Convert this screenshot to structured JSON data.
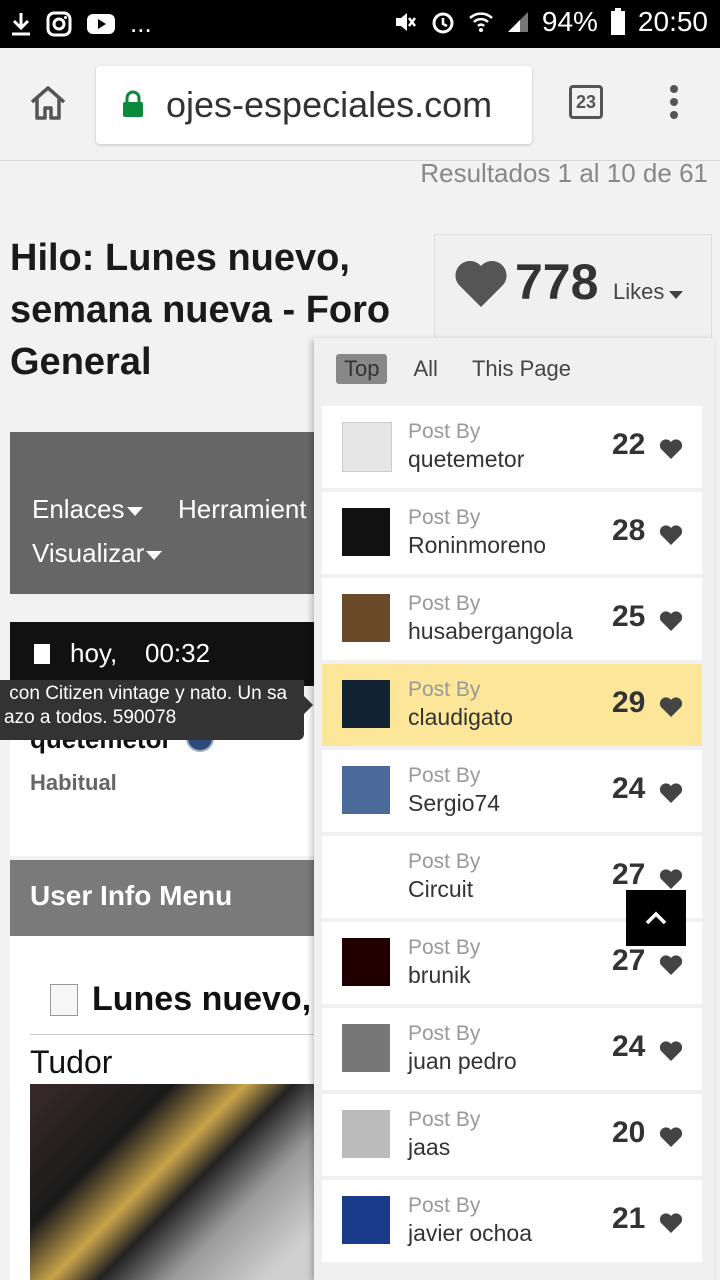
{
  "status_bar": {
    "left_icons": [
      "download-icon",
      "instagram-icon",
      "youtube-icon"
    ],
    "more": "...",
    "battery": "94%",
    "time": "20:50"
  },
  "browser": {
    "url": "ojes-especiales.com",
    "tab_count": "23"
  },
  "page": {
    "results_text": "Resultados 1 al 10 de 61",
    "thread_title": "Hilo: Lunes nuevo, semana nueva - Foro General",
    "nav": {
      "links": "Enlaces",
      "tools": "Herramient",
      "view": "Visualizar"
    },
    "date_day": "hoy,",
    "date_time": "00:32",
    "tooltip_text": " con Citizen vintage y nato. Un sa\nazo a todos. 590078",
    "username": "quetemetor",
    "user_rank": "Habitual",
    "user_info_menu": "User Info Menu",
    "post_title": "Lunes nuevo,",
    "post_brand": "Tudor"
  },
  "likes": {
    "count": "778",
    "label": "Likes",
    "filters": [
      "Top",
      "All",
      "This Page"
    ],
    "active_filter": "Top",
    "post_by_label": "Post By",
    "entries": [
      {
        "user": "quetemetor",
        "count": "22",
        "avatar": "default-avatar-icon",
        "highlight": false
      },
      {
        "user": "Roninmoreno",
        "count": "28",
        "avatar": "skull-avatar",
        "highlight": false
      },
      {
        "user": "husabergangola",
        "count": "25",
        "avatar": "motorcycle-avatar",
        "highlight": false
      },
      {
        "user": "claudigato",
        "count": "29",
        "avatar": "cat-avatar",
        "highlight": true
      },
      {
        "user": "Sergio74",
        "count": "24",
        "avatar": "cyclist-avatar",
        "highlight": false
      },
      {
        "user": "Circuit",
        "count": "27",
        "avatar": "skull-art-avatar",
        "highlight": false
      },
      {
        "user": "brunik",
        "count": "27",
        "avatar": "toucan-avatar",
        "highlight": false
      },
      {
        "user": "juan pedro",
        "count": "24",
        "avatar": "watch-avatar",
        "highlight": false
      },
      {
        "user": "jaas",
        "count": "20",
        "avatar": "wrist-watch-avatar",
        "highlight": false
      },
      {
        "user": "javier ochoa",
        "count": "21",
        "avatar": "night-scene-avatar",
        "highlight": false
      }
    ]
  },
  "colors": {
    "highlight_row": "#fbe699",
    "nav_bar": "#666666",
    "lock_green": "#0a8a3a"
  }
}
